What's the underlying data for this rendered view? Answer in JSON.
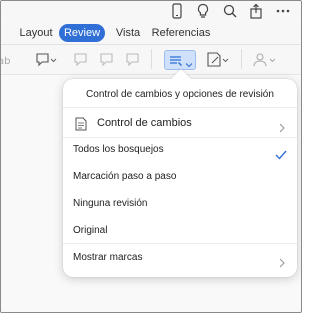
{
  "ribbon": {
    "tabs": [
      {
        "label": "Layout",
        "active": false
      },
      {
        "label": "Review",
        "active": true
      },
      {
        "label": "Vista",
        "active": false
      },
      {
        "label": "Referencias",
        "active": false
      }
    ]
  },
  "popover": {
    "title": "Control de cambios y opciones de revisión",
    "track_changes_label": "Control de cambios",
    "markup_options": [
      {
        "label": "Todos los bosquejos",
        "selected": true
      },
      {
        "label": "Marcación paso a paso",
        "selected": false
      },
      {
        "label": "Ninguna revisión",
        "selected": false
      },
      {
        "label": "Original",
        "selected": false
      }
    ],
    "show_markup_label": "Mostrar marcas"
  },
  "colors": {
    "accent": "#2f6fd6",
    "checkmark": "#2f6fd6",
    "selected_tool_bg": "#cfe0fb"
  },
  "icons": [
    "phone-icon",
    "lightbulb-icon",
    "search-icon",
    "share-icon",
    "more-icon",
    "comment-icon",
    "track-changes-icon",
    "review-pane-icon",
    "share-user-icon",
    "chevron-right-icon",
    "checkmark-icon",
    "document-icon"
  ]
}
